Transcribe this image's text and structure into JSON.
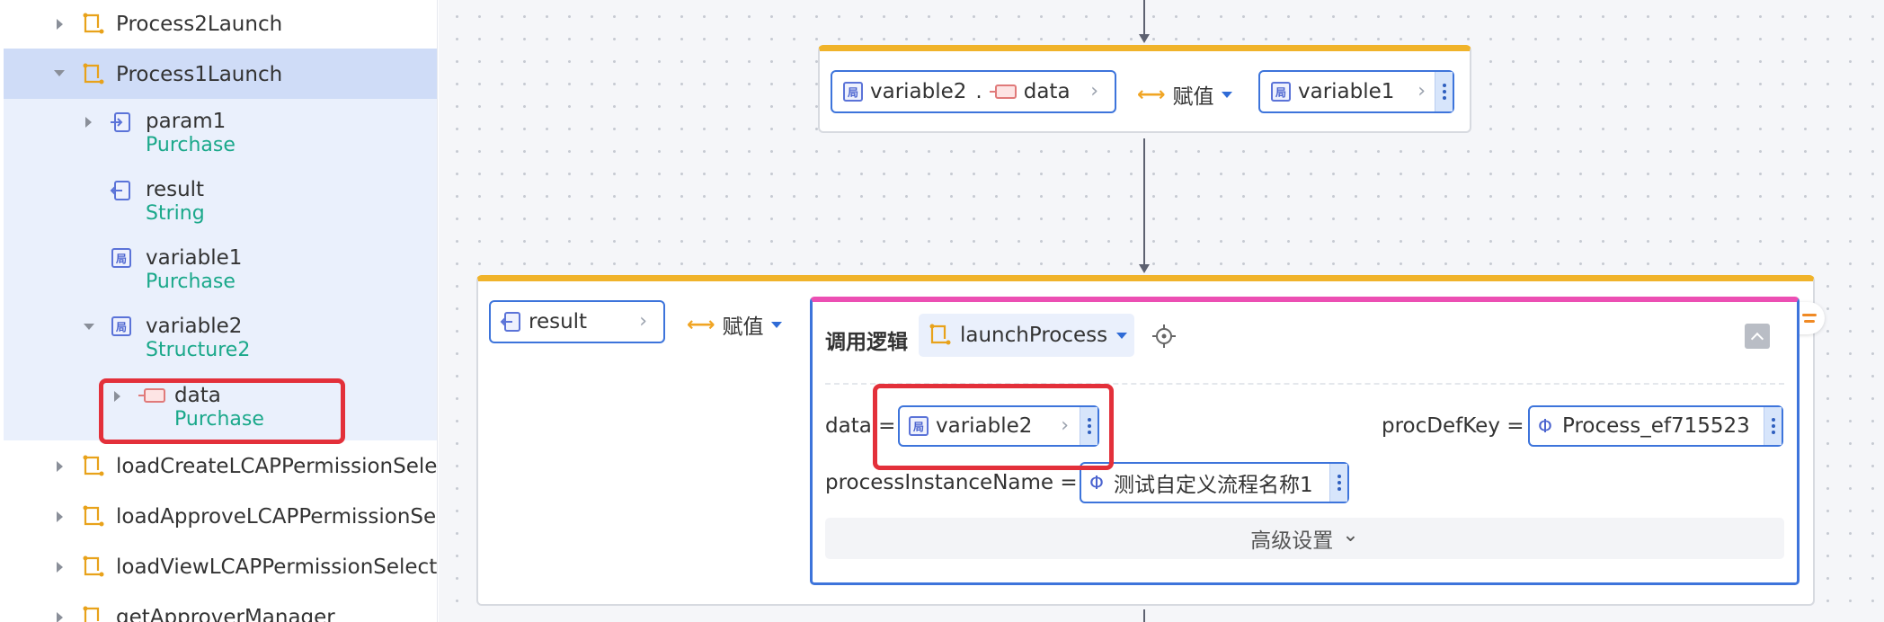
{
  "sidebar": {
    "items": [
      {
        "label": "Process2Launch"
      },
      {
        "label": "Process1Launch"
      },
      {
        "label": "param1",
        "type": "Purchase"
      },
      {
        "label": "result",
        "type": "String"
      },
      {
        "label": "variable1",
        "type": "Purchase"
      },
      {
        "label": "variable2",
        "type": "Structure2"
      },
      {
        "label": "data",
        "type": "Purchase"
      },
      {
        "label": "loadCreateLCAPPermissionSelec"
      },
      {
        "label": "loadApproveLCAPPermissionSel"
      },
      {
        "label": "loadViewLCAPPermissionSelect"
      },
      {
        "label": "getApproverManager"
      }
    ]
  },
  "node1": {
    "left_pill": {
      "icon_text": "局",
      "var": "variable2",
      "sep": ".",
      "field": "data"
    },
    "assign_label": "赋值",
    "right_pill": {
      "icon_text": "局",
      "var": "variable1"
    }
  },
  "node2": {
    "left_pill": {
      "var": "result"
    },
    "assign_label": "赋值",
    "panel": {
      "title": "调用逻辑",
      "logic_name": "launchProcess",
      "params": {
        "data_label": "data =",
        "data_value": "variable2",
        "data_icon": "局",
        "procdef_label": "procDefKey =",
        "procdef_value": "Process_ef715523",
        "procdef_icon": "Φ",
        "instance_label": "processInstanceName =",
        "instance_value": "测试自定义流程名称1",
        "instance_icon": "Φ"
      },
      "advanced_label": "高级设置",
      "advanced_chevron": "⌄"
    }
  },
  "icons": {
    "chevron": "›",
    "double_arrow": "⟷",
    "collapse": "collapse-icon",
    "locate": "crosshair-icon",
    "side_tab": "menu-lines-icon"
  },
  "colors": {
    "accent": "#3d74db",
    "node_top": "#f0b32a",
    "call_top": "#ec4fb3",
    "type_text": "#1aa88a",
    "highlight": "#e3303a",
    "selected_row": "#cfdcf7"
  }
}
